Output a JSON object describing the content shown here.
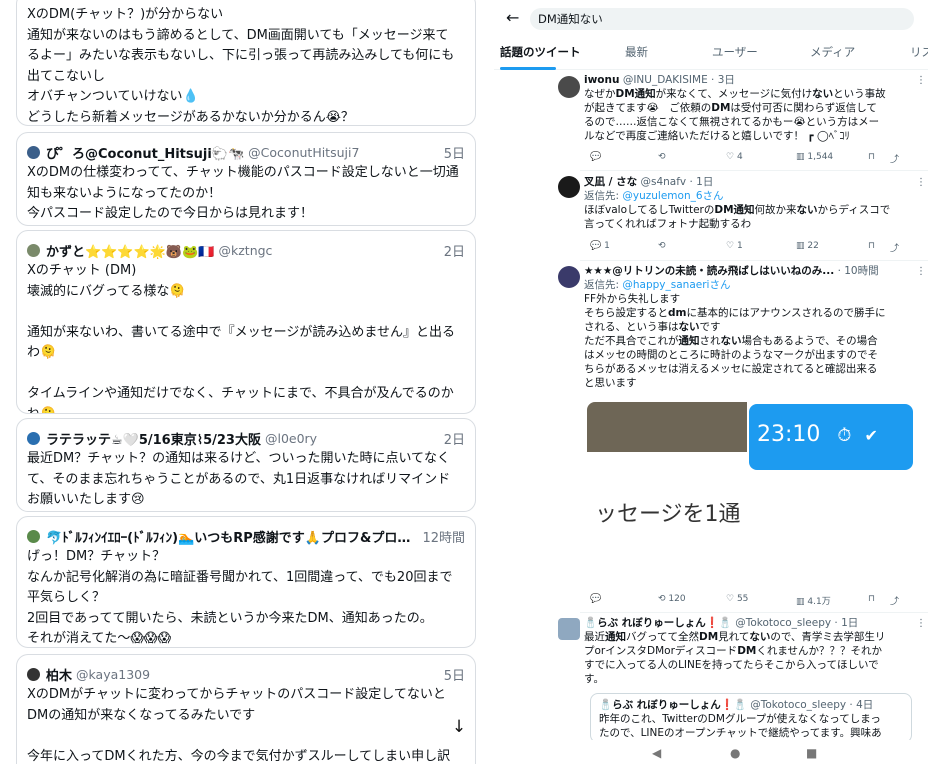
{
  "left": {
    "cards": [
      {
        "lines": [
          "XのDM(チャット？)が分からない",
          "通知が来ないのはもう諦めるとして、DM画面開いても「メッセージ来て",
          "るよー」みたいな表示もないし、下に引っ張って再読み込みしても何にも",
          "出てこないし",
          "オバチャンついていけない💧",
          "どうしたら新着メッセージがあるかないか分かるん😭？"
        ]
      },
      {
        "name": "ぴ゜ろ@Coconut_Hitsuji🐑🐄",
        "handle": "@CoconutHitsuji7",
        "date": "5日",
        "lines": [
          "XのDMの仕様変わってて、チャット機能のパスコード設定しないと一切通",
          "知も来ないようになってたのか！",
          "今パスコード設定したので今日からは見れます！"
        ]
      },
      {
        "name": "かずと⭐⭐⭐⭐🌟🐻🐸🇫🇷",
        "handle": "@kztngc",
        "date": "2日",
        "lines": [
          "Xのチャット (DM)",
          "壊滅的にバグってる様な🫠",
          "",
          "通知が来ないわ、書いてる途中で『メッセージが読み込めません』と出る",
          "わ🫠",
          "",
          "タイムラインや通知だけでなく、チャットにまで、不具合が及んでるのか",
          "ね🫠"
        ]
      },
      {
        "name": "ラテラッテ☕🤍5/16東京⌇5/23大阪",
        "handle": "@l0e0ry",
        "date": "2日",
        "lines": [
          "最近DM？チャット？の通知は来るけど、ついった開いた時に点いてなく",
          "て、そのまま忘れちゃうことがあるので、丸1日返事なければリマインド",
          "お願いいたします😢"
        ]
      },
      {
        "name": "🐬ﾄﾞﾙﾌｨﾝｲｴﾛｰ(ﾄﾞﾙﾌｨﾝ)🏊いつもRP感謝です🙏プロフ&プロカ...",
        "handle": "",
        "date": "12時間",
        "lines": [
          "げっ！DM？チャット？",
          "なんか記号化解消の為に暗証番号聞かれて、1回間違って、でも20回まで",
          "平気らしく？",
          "2回目であってて開いたら、未読というか今来たDM、通知あったの。",
          "それが消えてた〜😱😱😱"
        ]
      },
      {
        "name": "柏木",
        "handle": "@kaya1309",
        "date": "5日",
        "lines": [
          "XのDMがチャットに変わってからチャットのパスコード設定してないと",
          "DMの通知が来なくなってるみたいです",
          "",
          "今年に入ってDMくれた方、今の今まで気付かずスルーしてしまい申し訳"
        ]
      }
    ],
    "scroll_arrow": "↓"
  },
  "right": {
    "back_arrow": "←",
    "search_query": "DM通知ない",
    "tabs": [
      "話題のツイート",
      "最新",
      "ユーザー",
      "メディア",
      "リス"
    ],
    "tweets": [
      {
        "name": "iwonu",
        "handle": "@INU_DAKISIME · 3日",
        "lines": [
          "なぜか<b>DM通知</b>が来なくて、メッセージに気付け<b>ない</b>という事故",
          "が起きてます😭　ご依頼の<b>DM</b>は受付可否に関わらず返信して",
          "るので……返信こなくて無視されてるかもー😭という方はメー",
          "ルなどで再度ご連絡いただけると嬉しいです！ ┏ ◯ﾍﾞｺﾘ"
        ],
        "actions": {
          "reply": "",
          "retweet": "",
          "like": "4",
          "views": "1,544"
        }
      },
      {
        "name": "叉凪 / さな",
        "handle": "@s4nafv · 1日",
        "reply_prefix": "返信先: ",
        "reply_to": "@yuzulemon_6さん",
        "lines": [
          "ほぼvaloしてるしTwitterの<b>DM通知</b>何故か来<b>ない</b>からディスコで",
          "言ってくれればフォトナ起動するわ"
        ],
        "actions": {
          "reply": "1",
          "retweet": "",
          "like": "1",
          "views": "22"
        }
      },
      {
        "name": "★★★@リトリンの未読・読み飛ばしはいいねのみ...",
        "handle": "· 10時間",
        "reply_prefix": "返信先: ",
        "reply_to": "@happy_sanaeriさん",
        "lines": [
          "FF外から失礼します",
          "そちら設定すると<b>dm</b>に基本的にはアナウンスされるので勝手に",
          "される、という事は<b>ない</b>です",
          "ただ不具合でこれが<b>通知</b>され<b>ない</b>場合もあるようで、その場合",
          "はメッセの時間のところに時計のようなマークが出ますのでそ",
          "ちらがあるメッセは消えるメッセに設定されてると確認出来る",
          "と思います"
        ],
        "media": {
          "time": "23:10",
          "big_text": "ッセージを1通"
        },
        "actions": {
          "reply": "",
          "retweet": "120",
          "like": "55",
          "views": "4.1万"
        }
      },
      {
        "name": "🧂らぶ れぼりゅーしょん❗🧂",
        "handle": "@Tokotoco_sleepy · 1日",
        "lines": [
          "最近<b>通知</b>バグってて全然<b>DM</b>見れて<b>ない</b>ので、青学ミ去学部生リ",
          "プorインスタDMorディスコード<b>DM</b>くれませんか？？？それか",
          "すでに入ってる人のLINEを持ってたらそこから入ってほしいで",
          "す。"
        ],
        "quote": {
          "name": "🧂らぶ れぼりゅーしょん❗🧂",
          "handle": "@Tokotoco_sleepy · 4日",
          "lines": [
            "昨年のこれ、TwitterのDMグループが使えなくなってしまっ",
            "たので、LINEのオープンチャットで継続やってます。興味あ"
          ]
        }
      }
    ],
    "nav": [
      "◀",
      "●",
      "■"
    ]
  }
}
